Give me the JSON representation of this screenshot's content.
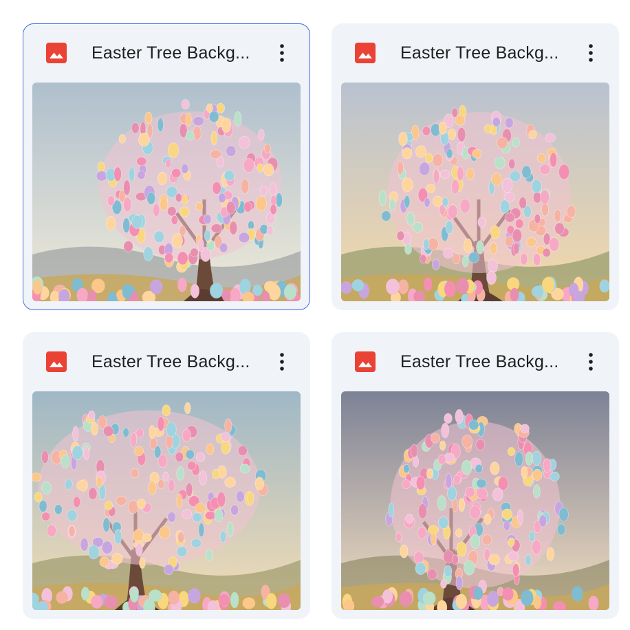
{
  "files": [
    {
      "title": "Easter Tree Backg...",
      "type_icon": "image-file-icon",
      "selected": true,
      "sky_top": "#aebfcd",
      "sky_bottom": "#f0ead8"
    },
    {
      "title": "Easter Tree Backg...",
      "type_icon": "image-file-icon",
      "selected": false,
      "sky_top": "#b9c2d0",
      "sky_bottom": "#f6d9a8"
    },
    {
      "title": "Easter Tree Backg...",
      "type_icon": "image-file-icon",
      "selected": false,
      "sky_top": "#9fb8c6",
      "sky_bottom": "#f3dcb4"
    },
    {
      "title": "Easter Tree Backg...",
      "type_icon": "image-file-icon",
      "selected": false,
      "sky_top": "#7d8296",
      "sky_bottom": "#f2ddc0"
    }
  ],
  "colors": {
    "card_bg": "#f0f4f9",
    "selected_border": "#3b6ee0",
    "image_icon": "#ea4335",
    "title_text": "#1f1f1f"
  }
}
